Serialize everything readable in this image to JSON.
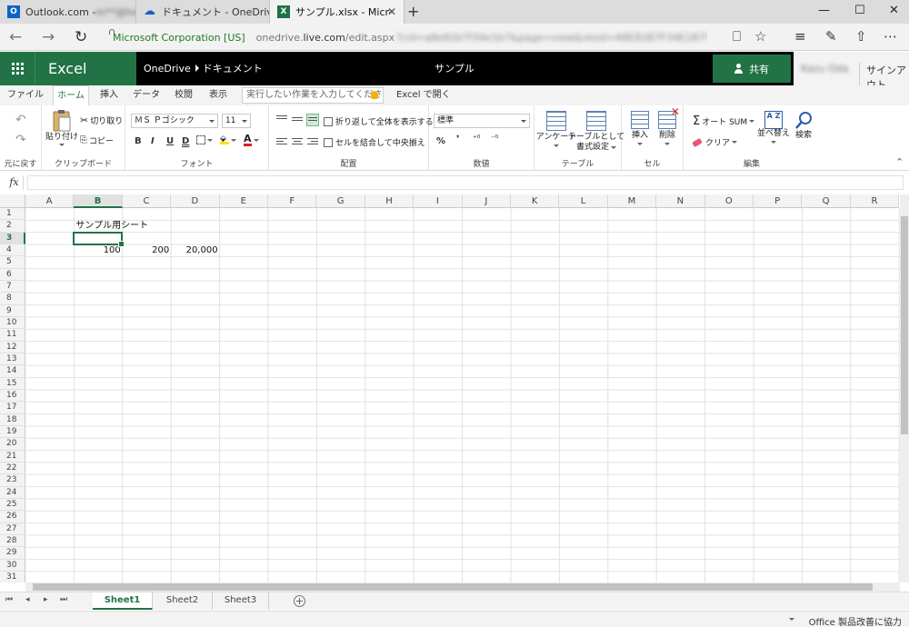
{
  "browser": {
    "tabs": [
      {
        "title": "Outlook.com - ",
        "blurred": "m**@hotr",
        "icon": "outlook-icon"
      },
      {
        "title": "ドキュメント - OneDrive",
        "icon": "onedrive-icon"
      },
      {
        "title": "サンプル.xlsx - Microsoft E",
        "icon": "excel-icon"
      }
    ],
    "new_tab": "+",
    "window_controls": {
      "minimize": "—",
      "maximize": "☐",
      "close": "✕"
    },
    "address": {
      "identity": "Microsoft Corporation [US]",
      "url_prefix": "onedrive.",
      "url_host": "live.com",
      "url_path": "/edit.aspx",
      "url_query": "?cid=a8e82b7f34e1b7&page=view&resid=A8E82B7F34E1B7!171&parId=A8E82B"
    },
    "toolbar_glyphs": {
      "reading": "⎕",
      "favorite": "☆",
      "hub": "≡",
      "note": "✎",
      "share": "⇧",
      "more": "⋯",
      "back": "←",
      "forward": "→",
      "refresh": "↻"
    }
  },
  "app": {
    "name": "Excel Online",
    "breadcrumb": {
      "root": "OneDrive",
      "folder": "ドキュメント"
    },
    "document_title": "サンプル",
    "share_label": "共有",
    "user_name": "Kazu Oda",
    "signout_label": "サインアウト"
  },
  "ribbon_tabs": [
    "ファイル",
    "ホーム",
    "挿入",
    "データ",
    "校閲",
    "表示"
  ],
  "active_tab": "ホーム",
  "tell_me": {
    "placeholder": "実行したい作業を入力してください"
  },
  "open_in_excel": "Excel で開く",
  "ribbon": {
    "undo_group": {
      "label": "元に戻す",
      "undo_glyph": "↶",
      "redo_glyph": "↷"
    },
    "clipboard": {
      "label": "クリップボード",
      "paste": "貼り付け",
      "cut": "切り取り",
      "copy": "コピー"
    },
    "font": {
      "label": "フォント",
      "family": "ＭＳ Ｐゴシック",
      "size": "11",
      "bold": "B",
      "italic": "I",
      "underline": "U",
      "double_underline": "D",
      "font_color_glyph": "A"
    },
    "alignment": {
      "label": "配置",
      "wrap": "折り返して全体を表示する",
      "merge": "セルを結合して中央揃え"
    },
    "number": {
      "label": "数値",
      "format": "標準",
      "percent": "%",
      "comma": "❜",
      "inc_decimal": "⁺⁰",
      "dec_decimal": "⁻⁰"
    },
    "tables": {
      "label": "テーブル",
      "survey": "アンケート",
      "format_table_1": "テーブルとして",
      "format_table_2": "書式設定"
    },
    "cells": {
      "label": "セル",
      "insert": "挿入",
      "delete": "削除"
    },
    "editing": {
      "label": "編集",
      "autosum": "オート SUM",
      "clear": "クリア",
      "sort": "並べ替え",
      "find": "検索",
      "sigma": "Σ"
    },
    "collapse_glyph": "⌃"
  },
  "formula_bar": {
    "fx": "fx",
    "value": ""
  },
  "grid": {
    "columns": [
      "A",
      "B",
      "C",
      "D",
      "E",
      "F",
      "G",
      "H",
      "I",
      "J",
      "K",
      "L",
      "M",
      "N",
      "O",
      "P",
      "Q",
      "R"
    ],
    "row_count": 31,
    "selected_column": "B",
    "selected_row": 3,
    "cells": [
      {
        "row": 2,
        "col": "B",
        "value": "サンプル用シート",
        "align": "left"
      },
      {
        "row": 4,
        "col": "B",
        "value": "100",
        "align": "right"
      },
      {
        "row": 4,
        "col": "C",
        "value": "200",
        "align": "right"
      },
      {
        "row": 4,
        "col": "D",
        "value": "20,000",
        "align": "right"
      }
    ]
  },
  "sheets": [
    "Sheet1",
    "Sheet2",
    "Sheet3"
  ],
  "active_sheet": "Sheet1",
  "sheet_nav": {
    "first": "⏮",
    "prev": "◂",
    "next": "▸",
    "last": "⏭",
    "add": "+"
  },
  "status": {
    "feedback": "Office 製品改善に協力"
  },
  "colors": {
    "excel_green": "#217346",
    "header_black": "#000000"
  }
}
